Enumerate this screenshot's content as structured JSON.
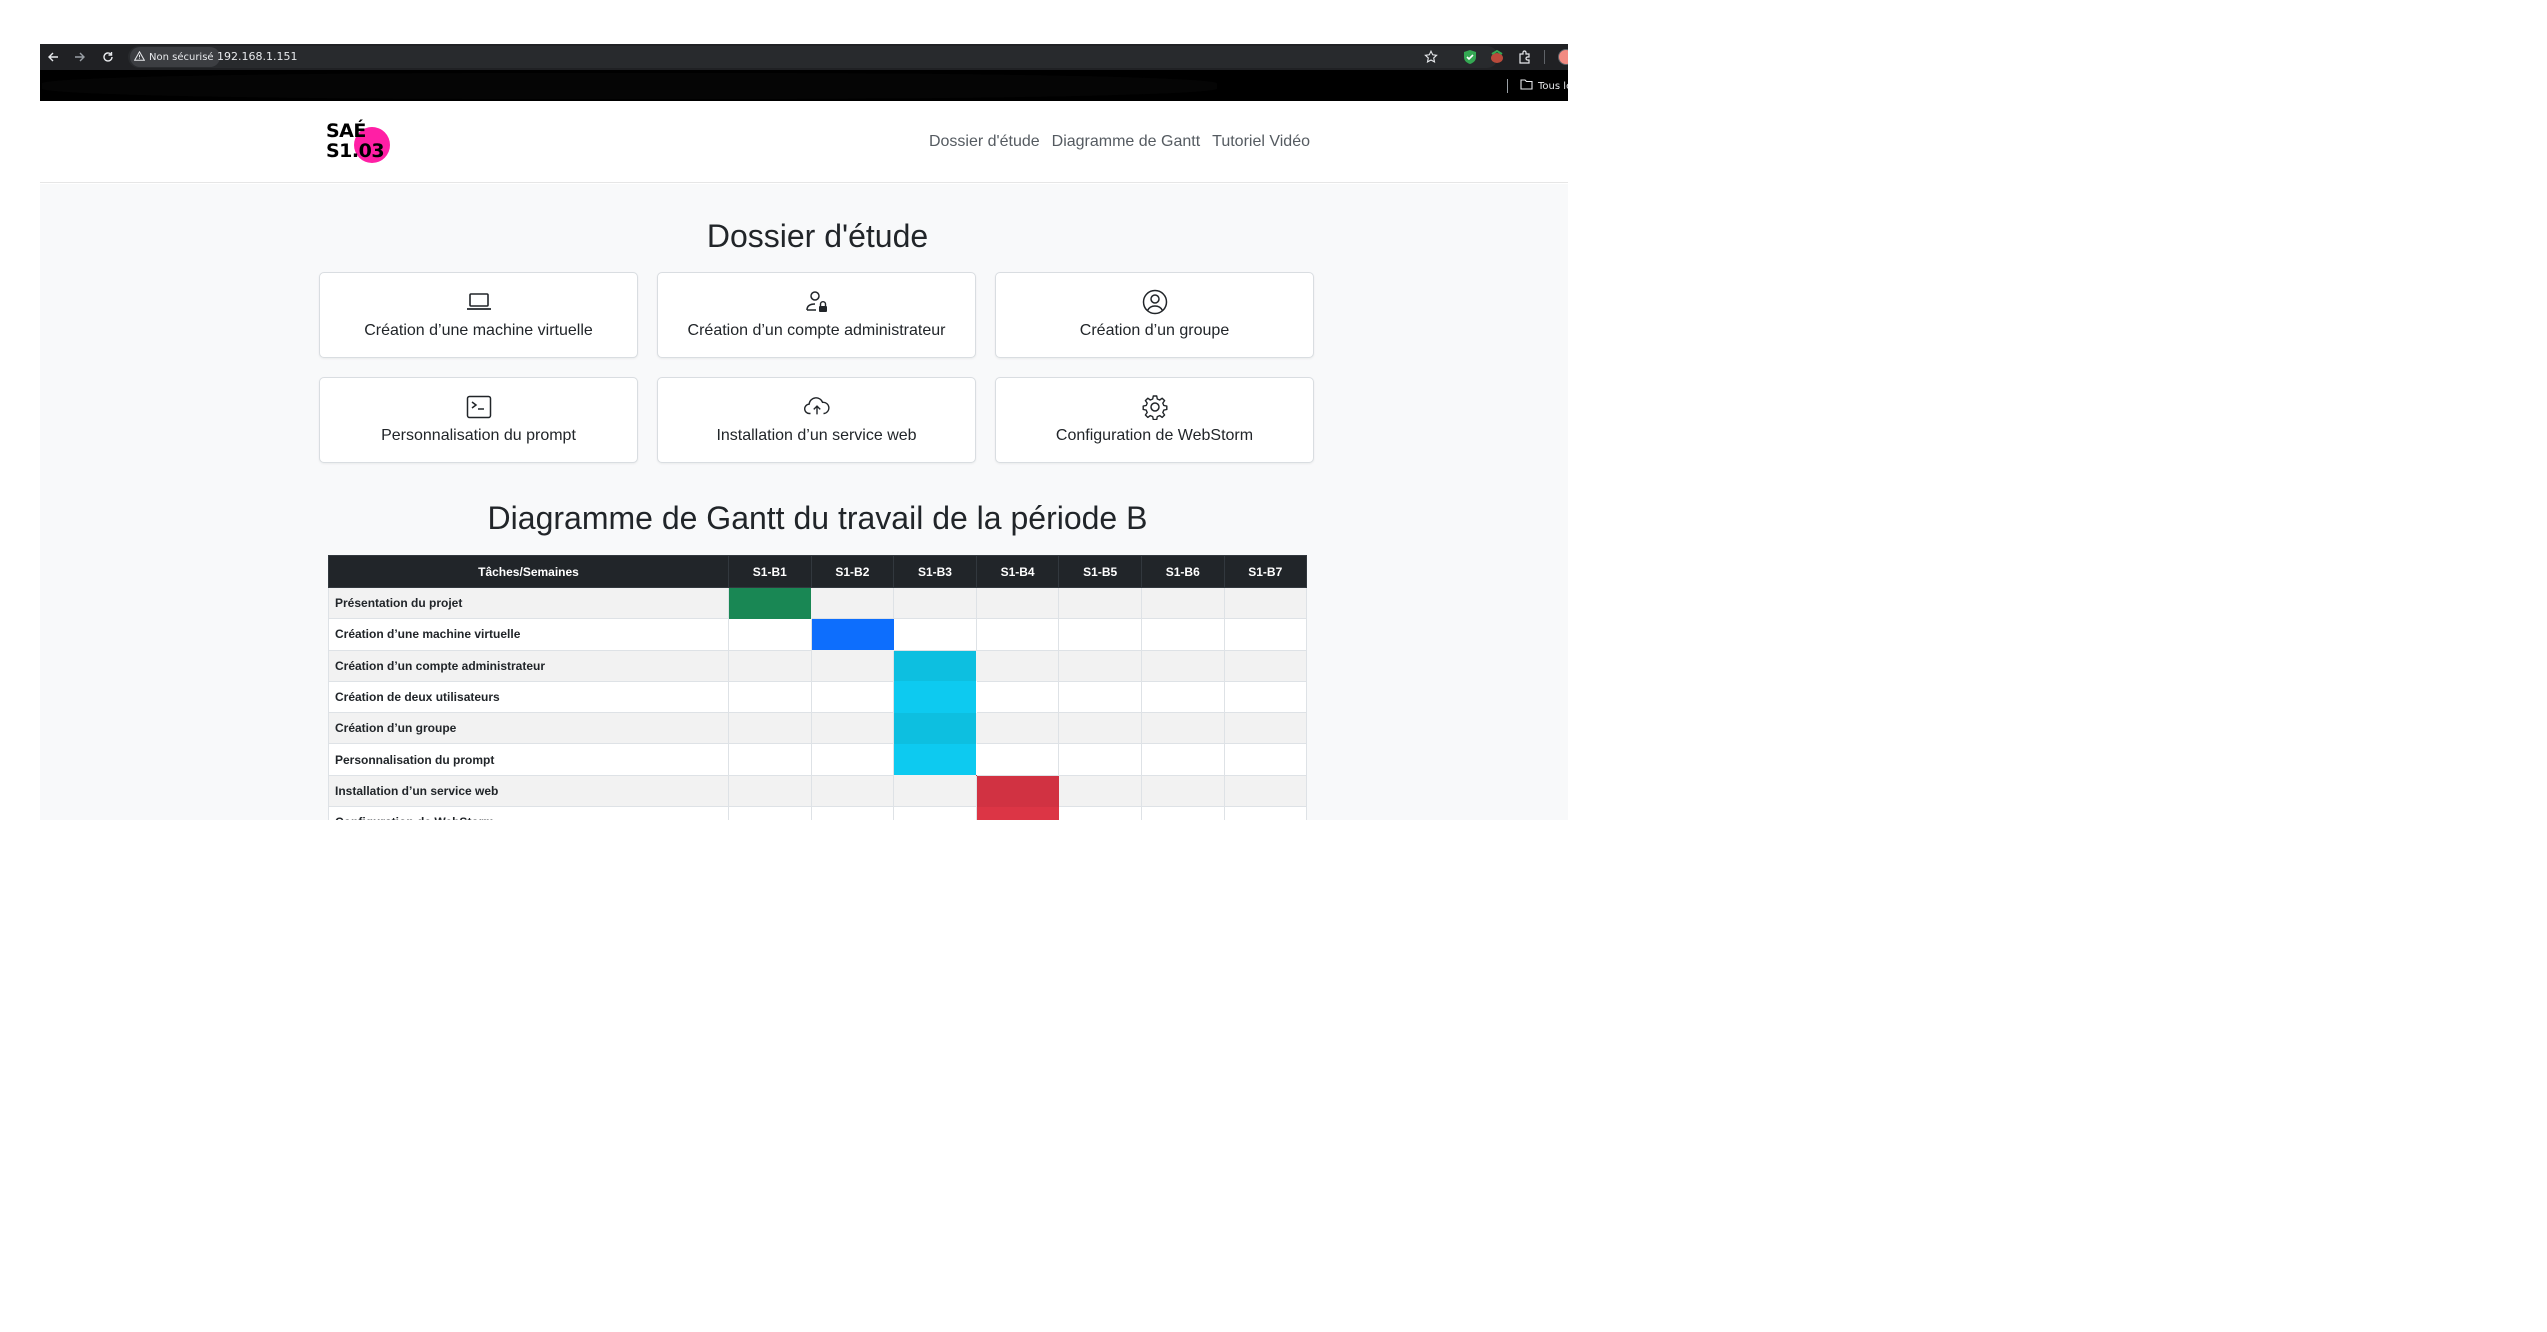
{
  "browser": {
    "security_label": "Non sécurisé",
    "url": "192.168.1.151",
    "all_bookmarks_label": "Tous les",
    "icons": [
      "back-arrow-icon",
      "forward-arrow-icon",
      "reload-icon",
      "warning-triangle-icon",
      "star-icon",
      "shield-extension-icon",
      "extension-icon",
      "puzzle-icon",
      "folder-icon"
    ]
  },
  "site": {
    "logo_line1": "SAÉ",
    "logo_line2": "S1.03",
    "logo_dot_color": "#ff1fa5",
    "nav": [
      "Dossier d'étude",
      "Diagramme de Gantt",
      "Tutoriel Vidéo"
    ]
  },
  "dossier": {
    "title": "Dossier d'étude",
    "cards": [
      {
        "label": "Création d’une machine virtuelle",
        "icon": "laptop-icon"
      },
      {
        "label": "Création d’un compte administrateur",
        "icon": "person-lock-icon"
      },
      {
        "label": "Création d’un groupe",
        "icon": "person-circle-icon"
      },
      {
        "label": "Personnalisation du prompt",
        "icon": "terminal-icon"
      },
      {
        "label": "Installation d’un service web",
        "icon": "cloud-upload-icon"
      },
      {
        "label": "Configuration de WebStorm",
        "icon": "gear-icon"
      }
    ]
  },
  "gantt": {
    "title": "Diagramme de Gantt du travail de la période B",
    "header_task": "Tâches/Semaines",
    "weeks": [
      "S1-B1",
      "S1-B2",
      "S1-B3",
      "S1-B4",
      "S1-B5",
      "S1-B6",
      "S1-B7"
    ],
    "colors": {
      "green": "#198754",
      "blue": "#0d6efd",
      "cyan": "#0dcaf0",
      "red": "#dc3545"
    },
    "rows": [
      {
        "task": "Présentation du projet",
        "week_index": 0,
        "color": "#198754"
      },
      {
        "task": "Création d’une machine virtuelle",
        "week_index": 1,
        "color": "#0d6efd"
      },
      {
        "task": "Création d’un compte administrateur",
        "week_index": 2,
        "color": "#0dbfe0"
      },
      {
        "task": "Création de deux utilisateurs",
        "week_index": 2,
        "color": "#0dcaf0"
      },
      {
        "task": "Création d’un groupe",
        "week_index": 2,
        "color": "#0dbfe0"
      },
      {
        "task": "Personnalisation du prompt",
        "week_index": 2,
        "color": "#0dcaf0"
      },
      {
        "task": "Installation d’un service web",
        "week_index": 3,
        "color": "#d13242"
      },
      {
        "task": "Configuration de WebStorm",
        "week_index": 3,
        "color": "#dc3545"
      }
    ]
  }
}
